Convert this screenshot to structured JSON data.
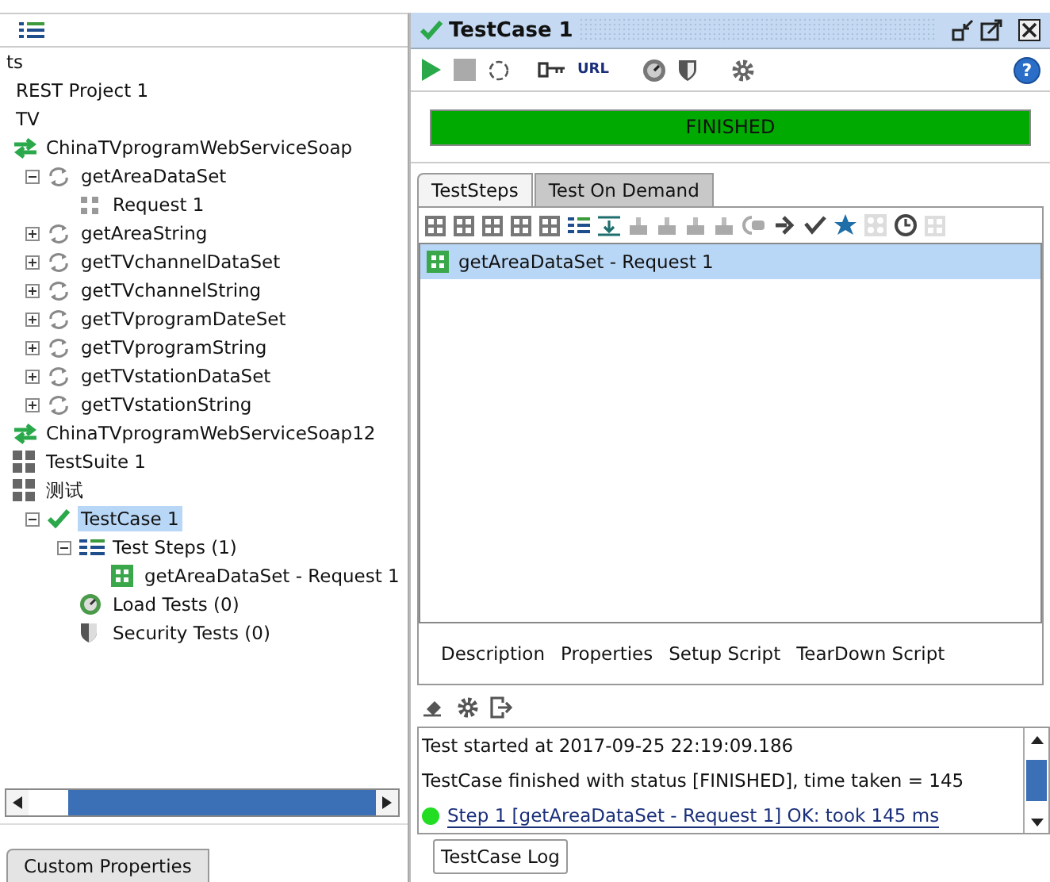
{
  "navigator": {
    "tree": [
      {
        "label": "ts",
        "children": [
          {
            "label": "REST Project 1"
          },
          {
            "label": "TV",
            "children": [
              {
                "label": "ChinaTVprogramWebServiceSoap",
                "kind": "interface",
                "children": [
                  {
                    "label": "getAreaDataSet",
                    "kind": "operation",
                    "expanded": true,
                    "children": [
                      {
                        "label": "Request 1",
                        "kind": "request"
                      }
                    ]
                  },
                  {
                    "label": "getAreaString",
                    "kind": "operation",
                    "expanded": false
                  },
                  {
                    "label": "getTVchannelDataSet",
                    "kind": "operation",
                    "expanded": false
                  },
                  {
                    "label": "getTVchannelString",
                    "kind": "operation",
                    "expanded": false
                  },
                  {
                    "label": "getTVprogramDateSet",
                    "kind": "operation",
                    "expanded": false
                  },
                  {
                    "label": "getTVprogramString",
                    "kind": "operation",
                    "expanded": false
                  },
                  {
                    "label": "getTVstationDataSet",
                    "kind": "operation",
                    "expanded": false
                  },
                  {
                    "label": "getTVstationString",
                    "kind": "operation",
                    "expanded": false
                  }
                ]
              },
              {
                "label": "ChinaTVprogramWebServiceSoap12",
                "kind": "interface"
              },
              {
                "label": "TestSuite 1",
                "kind": "suite"
              },
              {
                "label": "测试",
                "kind": "suite",
                "children": [
                  {
                    "label": "TestCase 1",
                    "kind": "case",
                    "expanded": true,
                    "selected": true,
                    "children": [
                      {
                        "label": "Test Steps (1)",
                        "kind": "steps",
                        "expanded": true,
                        "children": [
                          {
                            "label": "getAreaDataSet - Request 1",
                            "kind": "step"
                          }
                        ]
                      },
                      {
                        "label": "Load Tests (0)",
                        "kind": "load"
                      },
                      {
                        "label": "Security Tests (0)",
                        "kind": "security"
                      }
                    ]
                  }
                ]
              }
            ]
          }
        ]
      }
    ],
    "bottom_tab": "Custom Properties"
  },
  "editor": {
    "title": "TestCase 1",
    "toolbar": {
      "url_label": "URL",
      "help_label": "?"
    },
    "progress": {
      "label": "FINISHED",
      "level": 1
    },
    "tabs": [
      {
        "label": "TestSteps",
        "selected": true
      },
      {
        "label": "Test On Demand",
        "selected": false
      }
    ],
    "steps": [
      {
        "label": "getAreaDataSet - Request 1",
        "selected": true
      }
    ],
    "detail_tabs": [
      "Description",
      "Properties",
      "Setup Script",
      "TearDown Script"
    ],
    "log": [
      {
        "kind": "text",
        "text": "Test started at 2017-09-25 22:19:09.186"
      },
      {
        "kind": "text",
        "text": "TestCase finished with status [FINISHED], time taken = 145"
      },
      {
        "kind": "step",
        "text": "Step 1 [getAreaDataSet - Request 1] OK: took 145 ms",
        "color": "#22dd22"
      }
    ],
    "log_tab": "TestCase Log"
  }
}
